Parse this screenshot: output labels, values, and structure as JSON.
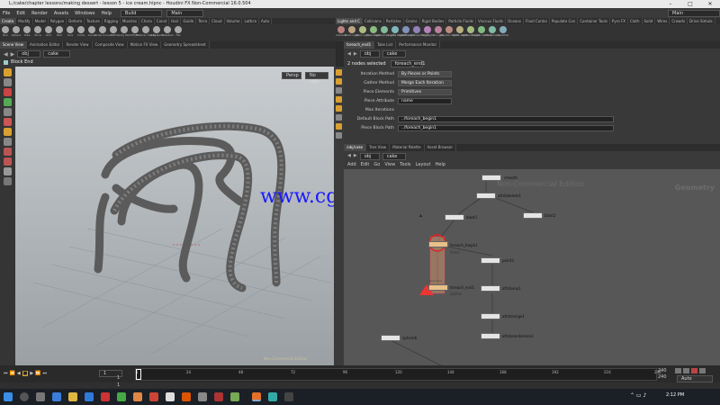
{
  "window": {
    "title": "L:/cake/chapter lessons/making dessert - lesson 5 - ice cream.hipnc - Houdini FX Non-Commercial 16.0.504",
    "controls": [
      "–",
      "□",
      "✕"
    ]
  },
  "menubar": {
    "items": [
      "File",
      "Edit",
      "Render",
      "Assets",
      "Windows",
      "Help"
    ],
    "build": "Build",
    "desktop": "Main",
    "right_desktop": "Main"
  },
  "shelf_left": {
    "tabs": [
      "Create",
      "Modify",
      "Model",
      "Polygon",
      "Deform",
      "Texture",
      "Rigging",
      "Muscles",
      "Chara",
      "Const",
      "Hair",
      "Guide",
      "Terra",
      "Cloud",
      "Volume",
      "Lattice",
      "Auto"
    ],
    "tools": [
      "Box",
      "Sphere",
      "Tube",
      "Torus",
      "Grid",
      "Null",
      "Line",
      "Circle",
      "Curve",
      "Draw Curve",
      "Path",
      "Spray Paint",
      "Font",
      "Platonic Solids",
      "L-System",
      "Metaball",
      "File"
    ]
  },
  "shelf_right": {
    "tabs": [
      "Lights and C",
      "Collisions",
      "Particles",
      "Grains",
      "Rigid Bodies",
      "Particle Fluids",
      "Viscous Fluids",
      "Oceans",
      "Fluid Contai",
      "Populate Con",
      "Container Tools",
      "Pyro FX",
      "Cloth",
      "Solid",
      "Wires",
      "Crowds",
      "Drive Simula"
    ],
    "tools": [
      "Camera",
      "Point Light",
      "Spot Light",
      "Area Light",
      "Geometry Light",
      "Volume Light",
      "Distant Light",
      "Environment Light",
      "Sky Light",
      "GI Light",
      "Caustic Light",
      "Portal Light",
      "Ambient Light",
      "Stereo Camera",
      "VR Camera",
      "Switcher"
    ]
  },
  "left_panetabs": [
    "Scene View",
    "Animation Editor",
    "Render View",
    "Composite View",
    "Motion FX View",
    "Geometry Spreadsheet"
  ],
  "viewport": {
    "path_obj": "obj",
    "path_node": "cake",
    "node_name": "Block End",
    "persp": "Persp",
    "camera": "No cam",
    "watermark": "Non-Commercial Edition"
  },
  "param_panetabs": [
    "foreach_end1",
    "Take List",
    "Performance Monitor"
  ],
  "params": {
    "path_obj": "obj",
    "path_node": "cake",
    "node_header": "foreach_end1",
    "selected": "2 nodes selected",
    "rows": [
      {
        "label": "Iteration Method",
        "value": "By Pieces or Points"
      },
      {
        "label": "Gather Method",
        "value": "Merge Each Iteration"
      },
      {
        "label": "Piece Elements",
        "value": "Primitives"
      },
      {
        "label": "Piece Attribute",
        "value": "name"
      },
      {
        "label": "Max Iterations",
        "value": ""
      },
      {
        "label": "Default Block Path",
        "value": "../foreach_begin1"
      },
      {
        "label": "Piece Block Path",
        "value": "../foreach_begin1"
      }
    ]
  },
  "net_panetabs": [
    "/obj/cake",
    "Tree View",
    "Material Palette",
    "Asset Browser"
  ],
  "network": {
    "menu": [
      "Add",
      "Edit",
      "Go",
      "View",
      "Tools",
      "Layout",
      "Help"
    ],
    "path_obj": "obj",
    "path_node": "cake",
    "context": "Geometry",
    "watermark": "Non-Commercial Edition",
    "nodes": [
      "smooth",
      "attribdelete1",
      "blast1",
      "blast2",
      "foreach_begin1",
      "Piece",
      "point3",
      "attribvop1",
      "foreach_end1",
      "Gather",
      "attribrange1",
      "attribrandomize3",
      "sphere6"
    ],
    "node_labels": {
      "smooth": "smooth",
      "attribdelete1": "attribdelete1",
      "blast1": "blast1",
      "blast2": "blast2",
      "foreach_begin1": "foreach_begin1",
      "piece": "Piece",
      "point3": "point3",
      "attribvop1": "attribvop1",
      "foreach_end1": "foreach_end1",
      "gather": "Gather",
      "attribrange1": "attribrange1",
      "attribrandomize3": "attribrandomize3",
      "sphere6": "sphere6",
      "block_end": "Block End"
    }
  },
  "watermark_site": "www.cgtsj.com",
  "timeline": {
    "frame": "1",
    "start": "1",
    "start2": "1",
    "ticks": [
      "1",
      "24",
      "48",
      "72",
      "96",
      "120",
      "144",
      "168",
      "192",
      "216",
      "240"
    ],
    "end": "240",
    "end2": "240",
    "auto_update": "Auto Update"
  },
  "taskbar": {
    "time": "2:12 PM",
    "date": "",
    "search": "Search"
  }
}
